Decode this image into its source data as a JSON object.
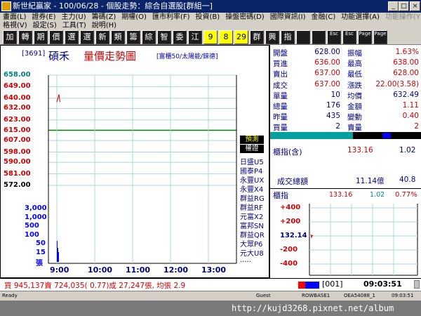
{
  "window": {
    "title": "新世紀贏家 - 100/06/28 - 個股走勢：綜合自選股[群組一]"
  },
  "menu": {
    "row1": [
      "畫面(L)",
      "證券(E)",
      "主力(U)",
      "籌碼(Z)",
      "期權(O)",
      "匯市利率(F)",
      "投資(B)",
      "操盤密碼(D)",
      "國際資訊(I)",
      "金融(C)",
      "功能選擇(A)",
      "功能操作(Y)"
    ],
    "row2": [
      "格視(V)",
      "設定(S)",
      "工具(T)",
      "說明(H)"
    ]
  },
  "toolbar": [
    "加",
    "轉",
    "期",
    "價",
    "選",
    "選",
    "新",
    "類",
    "籌",
    "綜",
    "智",
    "委",
    "江",
    "9",
    "8",
    "29",
    "群",
    "興",
    "指",
    "",
    "",
    "Esc",
    "Esc",
    "Page",
    "Page"
  ],
  "chart": {
    "code": "3691",
    "name": "碩禾",
    "title": "量價走勢圖",
    "subtitle": "富櫃50/太陽能/錸德",
    "price_labels": [
      "658.00",
      "649.00",
      "640.00",
      "632.00",
      "623.00",
      "615.00",
      "607.00",
      "598.00",
      "590.00",
      "581.00",
      "572.00"
    ],
    "volume_labels": [
      "3,000",
      "1,000",
      "500",
      "100",
      "50",
      "15",
      "張"
    ],
    "time_labels": [
      "9:00",
      "10:00",
      "11:00",
      "12:00",
      "13:00"
    ],
    "legend_active": "預測",
    "legend_second": "權證",
    "brokers": [
      "日盛U5",
      "國泰P4",
      "永豐UX",
      "永豐X4",
      "群益RG",
      "群益RF",
      "元富X2",
      "富邦SN",
      "群益QR",
      "大眾P6",
      "元大U8",
      "....."
    ]
  },
  "chart_data": {
    "type": "line",
    "x": [
      "9:00",
      "9:01",
      "9:02",
      "9:03"
    ],
    "series": [
      {
        "values": [
          637.0,
          640.0,
          643.0,
          637.0
        ]
      }
    ],
    "ylim": [
      572.0,
      658.0
    ],
    "reference": 615.0
  },
  "quote": {
    "rows": [
      [
        "開盤",
        "628.00",
        "振幅",
        "1.63%"
      ],
      [
        "買進",
        "636.00",
        "最高",
        "638.00"
      ],
      [
        "賣出",
        "637.00",
        "最低",
        "628.00"
      ],
      [
        "成交",
        "637.00",
        "漲跌",
        "22.00(3.58)"
      ],
      [
        "單量",
        "10",
        "均價",
        "632.49"
      ],
      [
        "總量",
        "176",
        "金額",
        "1.11"
      ],
      [
        "昨量",
        "435",
        "變動",
        "0.40"
      ],
      [
        "買量",
        "2",
        "賣量",
        "2"
      ]
    ]
  },
  "counter": {
    "label": "櫃指(含)",
    "value1": "133.16",
    "value2": "1.02"
  },
  "total": {
    "label": "成交總額",
    "value1": "11.14億",
    "value2": "40.8"
  },
  "index": {
    "label": "櫃指",
    "value": "133.16",
    "change": "1.02",
    "pct": "0.77%",
    "scale": [
      "+400",
      "+200",
      "132.14",
      "-200",
      "-400"
    ]
  },
  "ticker": {
    "text": "買 945,137賣 724,035( 0.77)成 27,247張, 均張 2.9",
    "code": "001",
    "time": "09:03:51"
  },
  "status": {
    "ready": "Ready",
    "user": "Guest",
    "f1": "ROWBASE1",
    "f2": "OEA54088_1",
    "f3": "09:03:51"
  },
  "watermark": "http://kujd3268.pixnet.net/album"
}
